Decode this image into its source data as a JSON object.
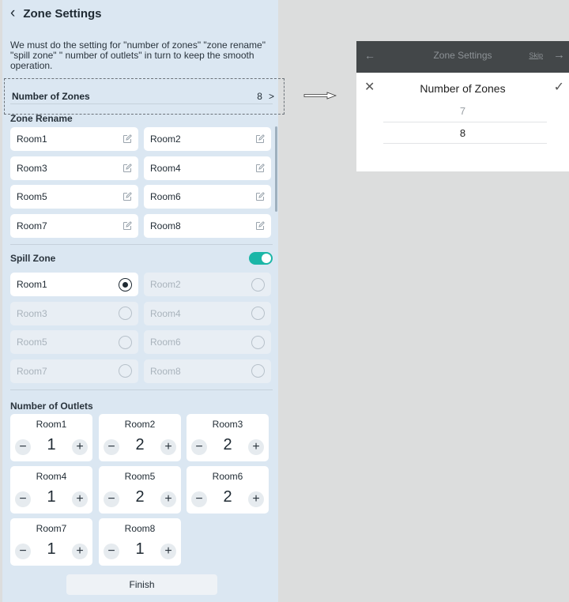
{
  "left": {
    "header": {
      "back_icon": "chevron-left-icon",
      "title": "Zone Settings"
    },
    "description": "We must do the setting for \"number of zones\" \"zone rename\" \"spill zone\" \" number of outlets\" in turn to keep the smooth operation.",
    "zones": {
      "label": "Number of Zones",
      "value": "8",
      "chevron": ">"
    },
    "rename": {
      "title": "Zone Rename",
      "rooms": [
        "Room1",
        "Room2",
        "Room3",
        "Room4",
        "Room5",
        "Room6",
        "Room7",
        "Room8"
      ]
    },
    "spill": {
      "title": "Spill Zone",
      "enabled": true,
      "rooms": [
        "Room1",
        "Room2",
        "Room3",
        "Room4",
        "Room5",
        "Room6",
        "Room7",
        "Room8"
      ],
      "selected": "Room1"
    },
    "outlets": {
      "title": "Number of Outlets",
      "rooms": [
        {
          "name": "Room1",
          "count": "1"
        },
        {
          "name": "Room2",
          "count": "2"
        },
        {
          "name": "Room3",
          "count": "2"
        },
        {
          "name": "Room4",
          "count": "1"
        },
        {
          "name": "Room5",
          "count": "2"
        },
        {
          "name": "Room6",
          "count": "2"
        },
        {
          "name": "Room7",
          "count": "1"
        },
        {
          "name": "Room8",
          "count": "1"
        }
      ],
      "minus": "−",
      "plus": "+"
    },
    "finish": "Finish"
  },
  "right": {
    "header": {
      "title": "Zone Settings",
      "skip": "Skip",
      "back": "←",
      "forward": "→"
    },
    "sheet": {
      "close": "✕",
      "title": "Number of Zones",
      "confirm": "✓",
      "previous_option": "7",
      "selected_option": "8"
    }
  },
  "colors": {
    "accent": "#1bb6a7",
    "panel": "#dbe7f2",
    "header_dark": "#434749"
  }
}
